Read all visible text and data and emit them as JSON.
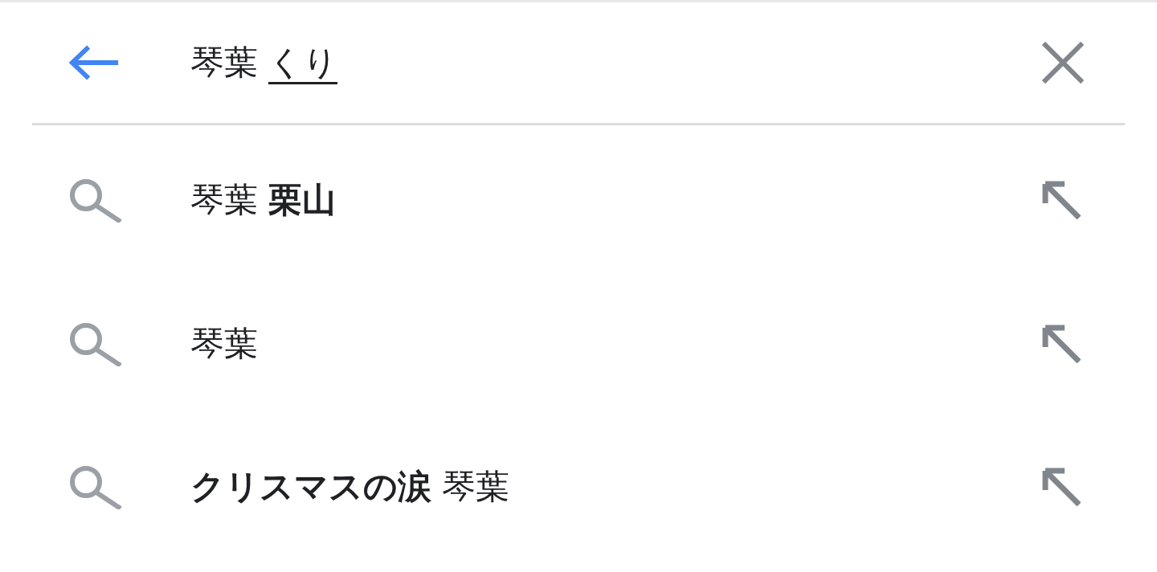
{
  "search_bar": {
    "query": "琴葉 ",
    "composing": "くり"
  },
  "suggestions": [
    {
      "text": "琴葉 **栗山**"
    },
    {
      "text": "琴葉"
    },
    {
      "text": "**クリスマスの涙** 琴葉"
    }
  ]
}
